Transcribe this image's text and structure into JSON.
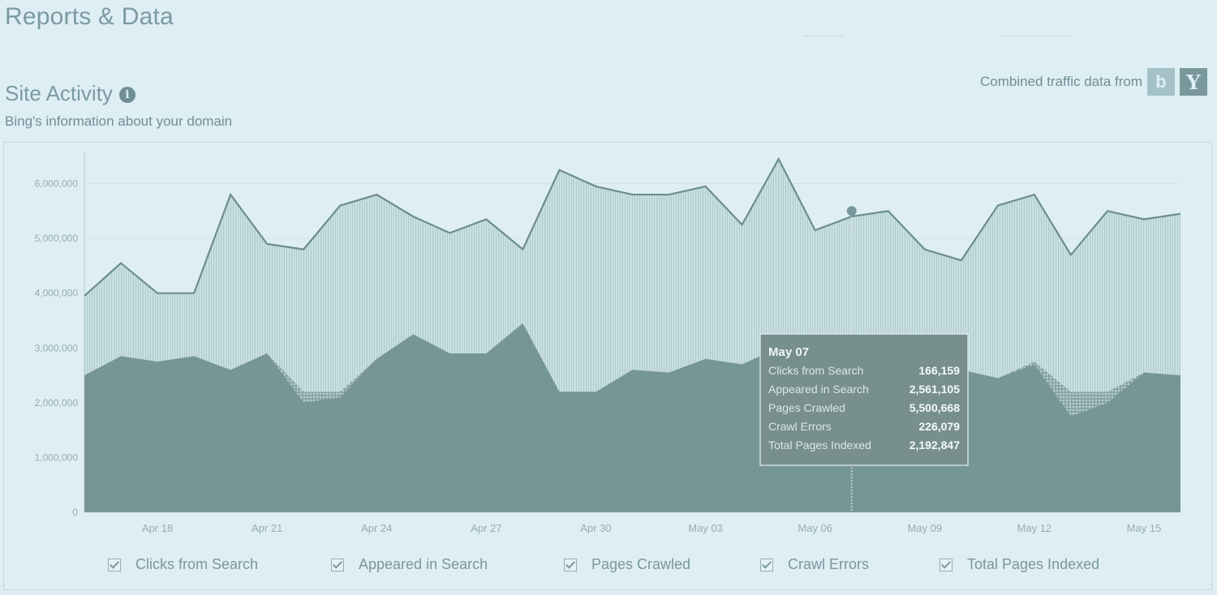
{
  "header": {
    "title": "Reports & Data"
  },
  "section": {
    "title": "Site Activity",
    "subtitle": "Bing's information about your domain",
    "info_icon": "info-icon"
  },
  "traffic": {
    "label": "Combined traffic data from",
    "sources": [
      {
        "name": "bing-icon",
        "glyph": "b"
      },
      {
        "name": "yahoo-icon",
        "glyph": "Y"
      }
    ]
  },
  "colors": {
    "background": "#deeef5",
    "appeared_fill": "#b7d2d6",
    "clicks_fill": "#769693",
    "line": "#6c8d8f"
  },
  "chart_data": {
    "type": "area",
    "ylim": [
      0,
      6600000
    ],
    "y_ticks": [
      "0",
      "1,000,000",
      "2,000,000",
      "3,000,000",
      "4,000,000",
      "5,000,000",
      "6,000,000"
    ],
    "x_tick_labels": [
      "Apr 18",
      "Apr 21",
      "Apr 24",
      "Apr 27",
      "Apr 30",
      "May 03",
      "May 06",
      "May 09",
      "May 12",
      "May 15"
    ],
    "dates": [
      "Apr 16",
      "Apr 17",
      "Apr 18",
      "Apr 19",
      "Apr 20",
      "Apr 21",
      "Apr 22",
      "Apr 23",
      "Apr 24",
      "Apr 25",
      "Apr 26",
      "Apr 27",
      "Apr 28",
      "Apr 29",
      "Apr 30",
      "May 01",
      "May 02",
      "May 03",
      "May 04",
      "May 05",
      "May 06",
      "May 07",
      "May 08",
      "May 09",
      "May 10",
      "May 11",
      "May 12",
      "May 13",
      "May 14",
      "May 15",
      "May 16"
    ],
    "series": [
      {
        "name": "Pages Crawled",
        "values": [
          3950000,
          4550000,
          4000000,
          4000000,
          5800000,
          4900000,
          4800000,
          5600000,
          5800000,
          5400000,
          5100000,
          5350000,
          4800000,
          6250000,
          5950000,
          5800000,
          5800000,
          5950000,
          5250000,
          6450000,
          5150000,
          5400000,
          5500668,
          4800000,
          4600000,
          5600000,
          5800000,
          4700000,
          5500000,
          5350000,
          5450000
        ]
      },
      {
        "name": "Appeared in Search",
        "values": [
          2500000,
          2850000,
          2750000,
          2850000,
          2600000,
          2900000,
          2200000,
          2200000,
          2800000,
          3250000,
          2900000,
          2900000,
          3450000,
          2200000,
          2200000,
          2600000,
          2550000,
          2800000,
          2700000,
          3000000,
          2950000,
          2561105,
          2300000,
          2500000,
          2600000,
          2450000,
          2750000,
          2200000,
          2200000,
          2550000,
          2500000
        ]
      },
      {
        "name": "Total Pages Indexed",
        "values": [
          2500000,
          2850000,
          2750000,
          2850000,
          2600000,
          2900000,
          2000000,
          2100000,
          2800000,
          3250000,
          2900000,
          2900000,
          3450000,
          2200000,
          2200000,
          2600000,
          2550000,
          2800000,
          2700000,
          3000000,
          2950000,
          2192847,
          2300000,
          2500000,
          2600000,
          2450000,
          2700000,
          1750000,
          2000000,
          2550000,
          2500000
        ]
      },
      {
        "name": "Clicks from Search",
        "values": []
      },
      {
        "name": "Crawl Errors",
        "values": []
      }
    ],
    "highlight": {
      "date": "May 07",
      "series": "Pages Crawled",
      "value": 5500668
    }
  },
  "tooltip": {
    "date": "May 07",
    "rows": [
      {
        "label": "Clicks from Search",
        "value": "166,159"
      },
      {
        "label": "Appeared in Search",
        "value": "2,561,105"
      },
      {
        "label": "Pages Crawled",
        "value": "5,500,668"
      },
      {
        "label": "Crawl Errors",
        "value": "226,079"
      },
      {
        "label": "Total Pages Indexed",
        "value": "2,192,847"
      }
    ]
  },
  "legend": [
    {
      "label": "Clicks from Search",
      "checked": true
    },
    {
      "label": "Appeared in Search",
      "checked": true
    },
    {
      "label": "Pages Crawled",
      "checked": true
    },
    {
      "label": "Crawl Errors",
      "checked": true
    },
    {
      "label": "Total Pages Indexed",
      "checked": true
    }
  ]
}
